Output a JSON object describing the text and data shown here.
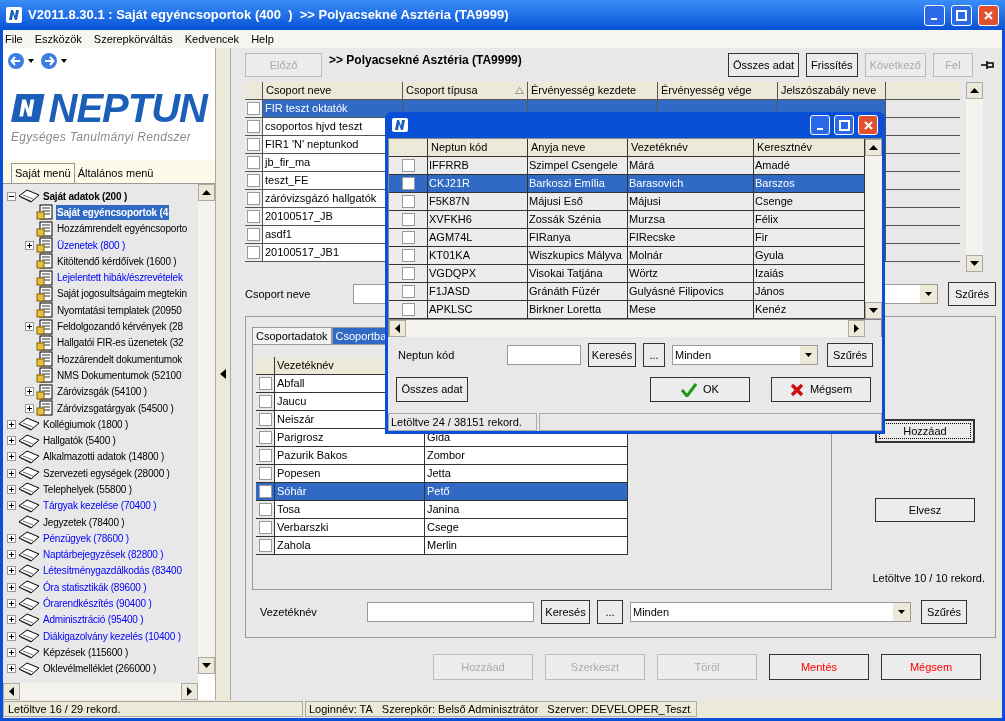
{
  "window": {
    "title": "V2011.8.30.1 : Saját egyéncsoportok (400  )  >> Polyacsekné Asztéria (TA9999)"
  },
  "menu": [
    "File",
    "Eszközök",
    "Szerepkörváltás",
    "Kedvencek",
    "Help"
  ],
  "logo": {
    "name": "NEPTUN",
    "subtitle": "Egységes Tanulmányi Rendszer"
  },
  "sidebar": {
    "tabs": [
      {
        "label": "Saját menü",
        "selected": true
      },
      {
        "label": "Általános menü",
        "selected": false
      }
    ],
    "tree": [
      {
        "label": "Saját adatok (200 )",
        "expandable": true,
        "expanded": true,
        "selected": false,
        "link": false,
        "children": [
          {
            "label": "Saját egyéncsoportok (4",
            "expandable": false,
            "selected": true
          },
          {
            "label": "Hozzámrendelt egyéncsoporto",
            "expandable": false,
            "selected": false,
            "link": false
          },
          {
            "label": "Üzenetek (800 )",
            "expandable": true,
            "expanded": false,
            "selected": false,
            "link": true
          },
          {
            "label": "Kitöltendő kérdőívek (1600 )",
            "expandable": false,
            "selected": false,
            "link": false
          },
          {
            "label": "Lejelentett hibák/észrevételek",
            "expandable": false,
            "selected": false,
            "link": true
          },
          {
            "label": "Saját jogosultságaim megtekin",
            "expandable": false,
            "selected": false,
            "link": false
          },
          {
            "label": "Nyomtatási templatek (20950",
            "expandable": false,
            "selected": false,
            "link": false
          },
          {
            "label": "Feldolgozandó kérvények (28",
            "expandable": true,
            "expanded": false,
            "selected": false,
            "link": false
          },
          {
            "label": "Hallgatói FIR-es üzenetek (32",
            "expandable": false,
            "selected": false,
            "link": false
          },
          {
            "label": "Hozzárendelt dokumentumok",
            "expandable": false,
            "selected": false,
            "link": false
          },
          {
            "label": "NMS Dokumentumok (52100",
            "expandable": false,
            "selected": false,
            "link": false
          },
          {
            "label": "Záróvizsgák (54100 )",
            "expandable": true,
            "expanded": false,
            "selected": false,
            "link": false
          },
          {
            "label": "Záróvizsgatárgyak (54500 )",
            "expandable": true,
            "expanded": false,
            "selected": false,
            "link": false
          }
        ]
      },
      {
        "label": "Kollégiumok (1800 )",
        "expandable": true,
        "expanded": false,
        "selected": false,
        "link": false
      },
      {
        "label": "Hallgatók (5400 )",
        "expandable": true,
        "expanded": false,
        "selected": false,
        "link": false
      },
      {
        "label": "Alkalmazotti adatok (14800 )",
        "expandable": true,
        "expanded": false,
        "selected": false,
        "link": false
      },
      {
        "label": "Szervezeti egységek (28000 )",
        "expandable": true,
        "expanded": false,
        "selected": false,
        "link": false
      },
      {
        "label": "Telephelyek (55800 )",
        "expandable": true,
        "expanded": false,
        "selected": false,
        "link": false
      },
      {
        "label": "Tárgyak kezelése (70400 )",
        "expandable": true,
        "expanded": false,
        "selected": false,
        "link": true
      },
      {
        "label": "Jegyzetek (78400 )",
        "expandable": false,
        "selected": false,
        "link": false
      },
      {
        "label": "Pénzügyek (78600 )",
        "expandable": true,
        "expanded": false,
        "selected": false,
        "link": true
      },
      {
        "label": "Naptárbejegyzések (82800 )",
        "expandable": true,
        "expanded": false,
        "selected": false,
        "link": true
      },
      {
        "label": "Létesítménygazdálkodás (83400",
        "expandable": true,
        "expanded": false,
        "selected": false,
        "link": true
      },
      {
        "label": "Óra statisztikák (89600 )",
        "expandable": true,
        "expanded": false,
        "selected": false,
        "link": true
      },
      {
        "label": "Órarendkészítés (90400 )",
        "expandable": true,
        "expanded": false,
        "selected": false,
        "link": true
      },
      {
        "label": "Adminisztráció (95400 )",
        "expandable": true,
        "expanded": false,
        "selected": false,
        "link": true
      },
      {
        "label": "Diákigazolvány kezelés (10400 )",
        "expandable": true,
        "expanded": false,
        "selected": false,
        "link": true
      },
      {
        "label": "Képzések (115600 )",
        "expandable": true,
        "expanded": false,
        "selected": false,
        "link": false
      },
      {
        "label": "Oklevélmelléklet (266000 )",
        "expandable": true,
        "expanded": false,
        "selected": false,
        "link": false
      }
    ]
  },
  "toolbar": {
    "prev": {
      "label": "Előző",
      "disabled": true
    },
    "heading": ">> Polyacsekné Asztéria (TA9999)",
    "buttons": [
      {
        "label": "Összes adat",
        "disabled": false
      },
      {
        "label": "Frissítés",
        "disabled": false
      },
      {
        "label": "Következő",
        "disabled": true
      },
      {
        "label": "Fel",
        "disabled": true
      }
    ]
  },
  "groups_table": {
    "columns": [
      {
        "label": "Csoport neve",
        "sorted": false
      },
      {
        "label": "Csoport típusa",
        "sorted": true
      },
      {
        "label": "Érvényesség kezdete",
        "sorted": false
      },
      {
        "label": "Érvényesség vége",
        "sorted": false
      },
      {
        "label": "Jelszószabály neve",
        "sorted": false
      }
    ],
    "rows": [
      {
        "name": "FIR teszt oktatók",
        "selected": true,
        "checked": false
      },
      {
        "name": "csoportos hjvd teszt",
        "selected": false,
        "checked": false
      },
      {
        "name": "FIR1 'N' neptunkod",
        "selected": false,
        "checked": false
      },
      {
        "name": "jb_fir_ma",
        "selected": false,
        "checked": false
      },
      {
        "name": "teszt_FE",
        "selected": false,
        "checked": false
      },
      {
        "name": "záróvizsgázó hallgatók",
        "selected": false,
        "checked": false
      },
      {
        "name": "20100517_JB",
        "selected": false,
        "checked": false
      },
      {
        "name": "asdf1",
        "selected": false,
        "checked": false
      },
      {
        "name": "20100517_JB1",
        "selected": false,
        "checked": false
      }
    ]
  },
  "groups_filter": {
    "label": "Csoport neve",
    "button": "Szűrés"
  },
  "member_panel": {
    "tabs": [
      {
        "label": "Csoportadatok",
        "selected": false
      },
      {
        "label": "Csoportba",
        "selected": true
      }
    ],
    "column": "Vezetéknév",
    "rows": [
      {
        "last": "Abfall",
        "selected": false,
        "checked": false
      },
      {
        "last": "Jaucu",
        "selected": false,
        "checked": false
      },
      {
        "last": "Neiszár",
        "selected": false,
        "checked": false
      },
      {
        "last": "Parigrosz",
        "first": "Gida",
        "selected": false,
        "checked": false
      },
      {
        "last": "Pazurik Bakos",
        "first": "Zombor",
        "selected": false,
        "checked": false
      },
      {
        "last": "Popesen",
        "first": "Jetta",
        "selected": false,
        "checked": false
      },
      {
        "last": "Sóhár",
        "first": "Pető",
        "selected": true,
        "checked": false
      },
      {
        "last": "Tosa",
        "first": "Janina",
        "selected": false,
        "checked": false
      },
      {
        "last": "Verbarszki",
        "first": "Csege",
        "selected": false,
        "checked": false
      },
      {
        "last": "Zahola",
        "first": "Merlin",
        "selected": false,
        "checked": false
      }
    ],
    "add_button": "Hozzáad",
    "remove_button": "Elvesz",
    "record_count": "Letöltve 10 / 10 rekord.",
    "filter": {
      "label": "Vezetéknév",
      "search": "Keresés",
      "more": "...",
      "select": "Minden",
      "button": "Szűrés"
    }
  },
  "actions": [
    {
      "label": "Hozzáad",
      "disabled": true,
      "kind": "normal"
    },
    {
      "label": "Szerkeszt",
      "disabled": true,
      "kind": "normal"
    },
    {
      "label": "Töröl",
      "disabled": true,
      "kind": "normal"
    },
    {
      "label": "Mentés",
      "disabled": false,
      "kind": "danger"
    },
    {
      "label": "Mégsem",
      "disabled": false,
      "kind": "danger"
    }
  ],
  "dialog": {
    "columns": [
      "Neptun kód",
      "Anyja neve",
      "Vezetéknév",
      "Keresztnév"
    ],
    "rows": [
      {
        "cells": [
          "IFFRRB",
          "Szimpel Csengele",
          "Márá",
          "Amadé"
        ],
        "selected": false,
        "checked": false
      },
      {
        "cells": [
          "CKJ21R",
          "Barkoszi Emília",
          "Barasovich",
          "Barszos"
        ],
        "selected": true,
        "checked": false
      },
      {
        "cells": [
          "F5K87N",
          "Májusi Eső",
          "Májusi",
          "Csenge"
        ],
        "selected": false,
        "checked": false
      },
      {
        "cells": [
          "XVFKH6",
          "Zossák Szénia",
          "Murzsa",
          "Félix"
        ],
        "selected": false,
        "checked": false
      },
      {
        "cells": [
          "AGM74L",
          "FIRanya",
          "FIRecske",
          "Fir"
        ],
        "selected": false,
        "checked": false
      },
      {
        "cells": [
          "KT01KA",
          "Wiszkupics Mályva",
          "Molnár",
          "Gyula"
        ],
        "selected": false,
        "checked": false
      },
      {
        "cells": [
          "VGDQPX",
          "Visokai Tatjána",
          "Wörtz",
          "Izaiás"
        ],
        "selected": false,
        "checked": false
      },
      {
        "cells": [
          "F1JASD",
          "Gránáth Füzér",
          "Gulyásné Filipovics",
          "János"
        ],
        "selected": false,
        "checked": false
      },
      {
        "cells": [
          "APKLSC",
          "Birkner Loretta",
          "Mese",
          "Kenéz"
        ],
        "selected": false,
        "checked": false
      }
    ],
    "filter": {
      "label": "Neptun kód",
      "search": "Keresés",
      "more": "...",
      "select": "Minden",
      "button": "Szűrés"
    },
    "all_button": "Összes adat",
    "ok": "OK",
    "cancel": "Mégsem",
    "status": "Letöltve 24 / 38151 rekord."
  },
  "status_bar": {
    "left": "Letöltve 16 / 29 rekord.",
    "fields": [
      "Loginnév: TA",
      "Szerepkör: Belső Adminisztrátor",
      "Szerver: DEVELOPER_Teszt"
    ]
  }
}
